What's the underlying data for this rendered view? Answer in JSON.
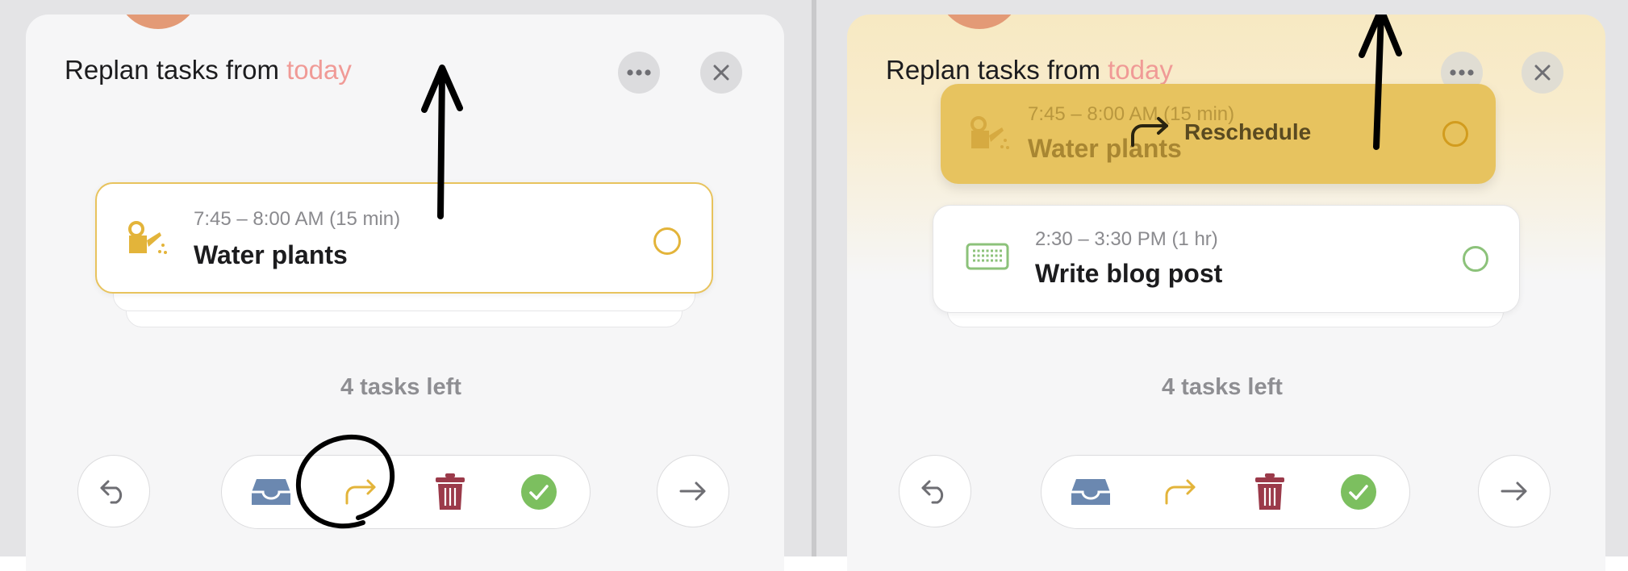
{
  "colors": {
    "accent_pink": "#f09a96",
    "task_yellow": "#e3b43a",
    "task_green": "#8cc27a",
    "trash_red": "#9b3a4a",
    "inbox_blue": "#6b88b0",
    "check_green": "#7cbf5f"
  },
  "left_panel": {
    "title_prefix": "Replan tasks from ",
    "title_accent": "today",
    "more_icon": "ellipsis-icon",
    "close_icon": "close-x-icon",
    "card": {
      "time": "7:45 – 8:00 AM (15 min)",
      "name": "Water plants",
      "icon": "watering-can-icon"
    },
    "tasks_left": "4 tasks left",
    "toolbar": {
      "undo_icon": "undo-arrow-icon",
      "inbox_icon": "inbox-tray-icon",
      "reschedule_icon": "reschedule-arrow-icon",
      "trash_icon": "trash-icon",
      "complete_icon": "check-circle-icon",
      "next_icon": "right-arrow-icon"
    }
  },
  "right_panel": {
    "title_prefix": "Replan tasks from ",
    "title_accent": "today",
    "dragging_card": {
      "time": "7:45 – 8:00 AM (15 min)",
      "name": "Water plants",
      "action_label": "Reschedule",
      "icon": "watering-can-icon"
    },
    "next_card": {
      "time": "2:30 – 3:30 PM (1 hr)",
      "name": "Write blog post",
      "icon": "keyboard-icon"
    },
    "tasks_left": "4 tasks left"
  }
}
